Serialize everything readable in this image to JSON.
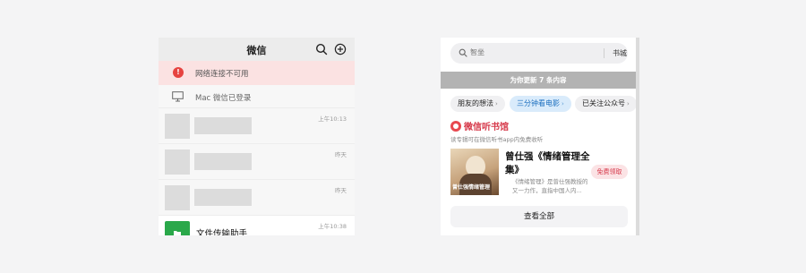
{
  "wechat": {
    "title": "微信",
    "search_icon": "search-icon",
    "add_icon": "plus-circle-icon",
    "network_warning": "网络连接不可用",
    "mac_login": "Mac 微信已登录",
    "chats": [
      {
        "time": "上午10:13"
      },
      {
        "time": "昨天"
      },
      {
        "time": "昨天"
      }
    ],
    "file_transfer": {
      "name": "文件传输助手",
      "time": "上午10:38"
    }
  },
  "reader": {
    "search": {
      "placeholder": "智坐"
    },
    "bookstore_label": "书城",
    "update_notice": "为你更新 7 条内容",
    "chips": [
      {
        "label": "朋友的想法",
        "arrow": "›"
      },
      {
        "label": "三分钟看电影",
        "arrow": "›"
      },
      {
        "label": "已关注公众号",
        "arrow": "›"
      }
    ],
    "library": {
      "title": "微信听书馆",
      "subtitle": "读专辑可在微信听书app内免费收听"
    },
    "book": {
      "title": "曾仕强《情绪管理全集》",
      "description": "《情绪管理》是曾仕强教授的又一力作，直指中国人内...",
      "cover_text": "曾仕强情绪管理",
      "free_button": "免费领取"
    },
    "view_all": "查看全部"
  },
  "colors": {
    "warning_bg": "#fbe2e2",
    "warning_icon": "#e64340",
    "accent_red": "#d6394a",
    "chip_active_bg": "#d9ebfb",
    "chip_active_text": "#1c6fbf",
    "file_transfer_green": "#2aa84a"
  }
}
